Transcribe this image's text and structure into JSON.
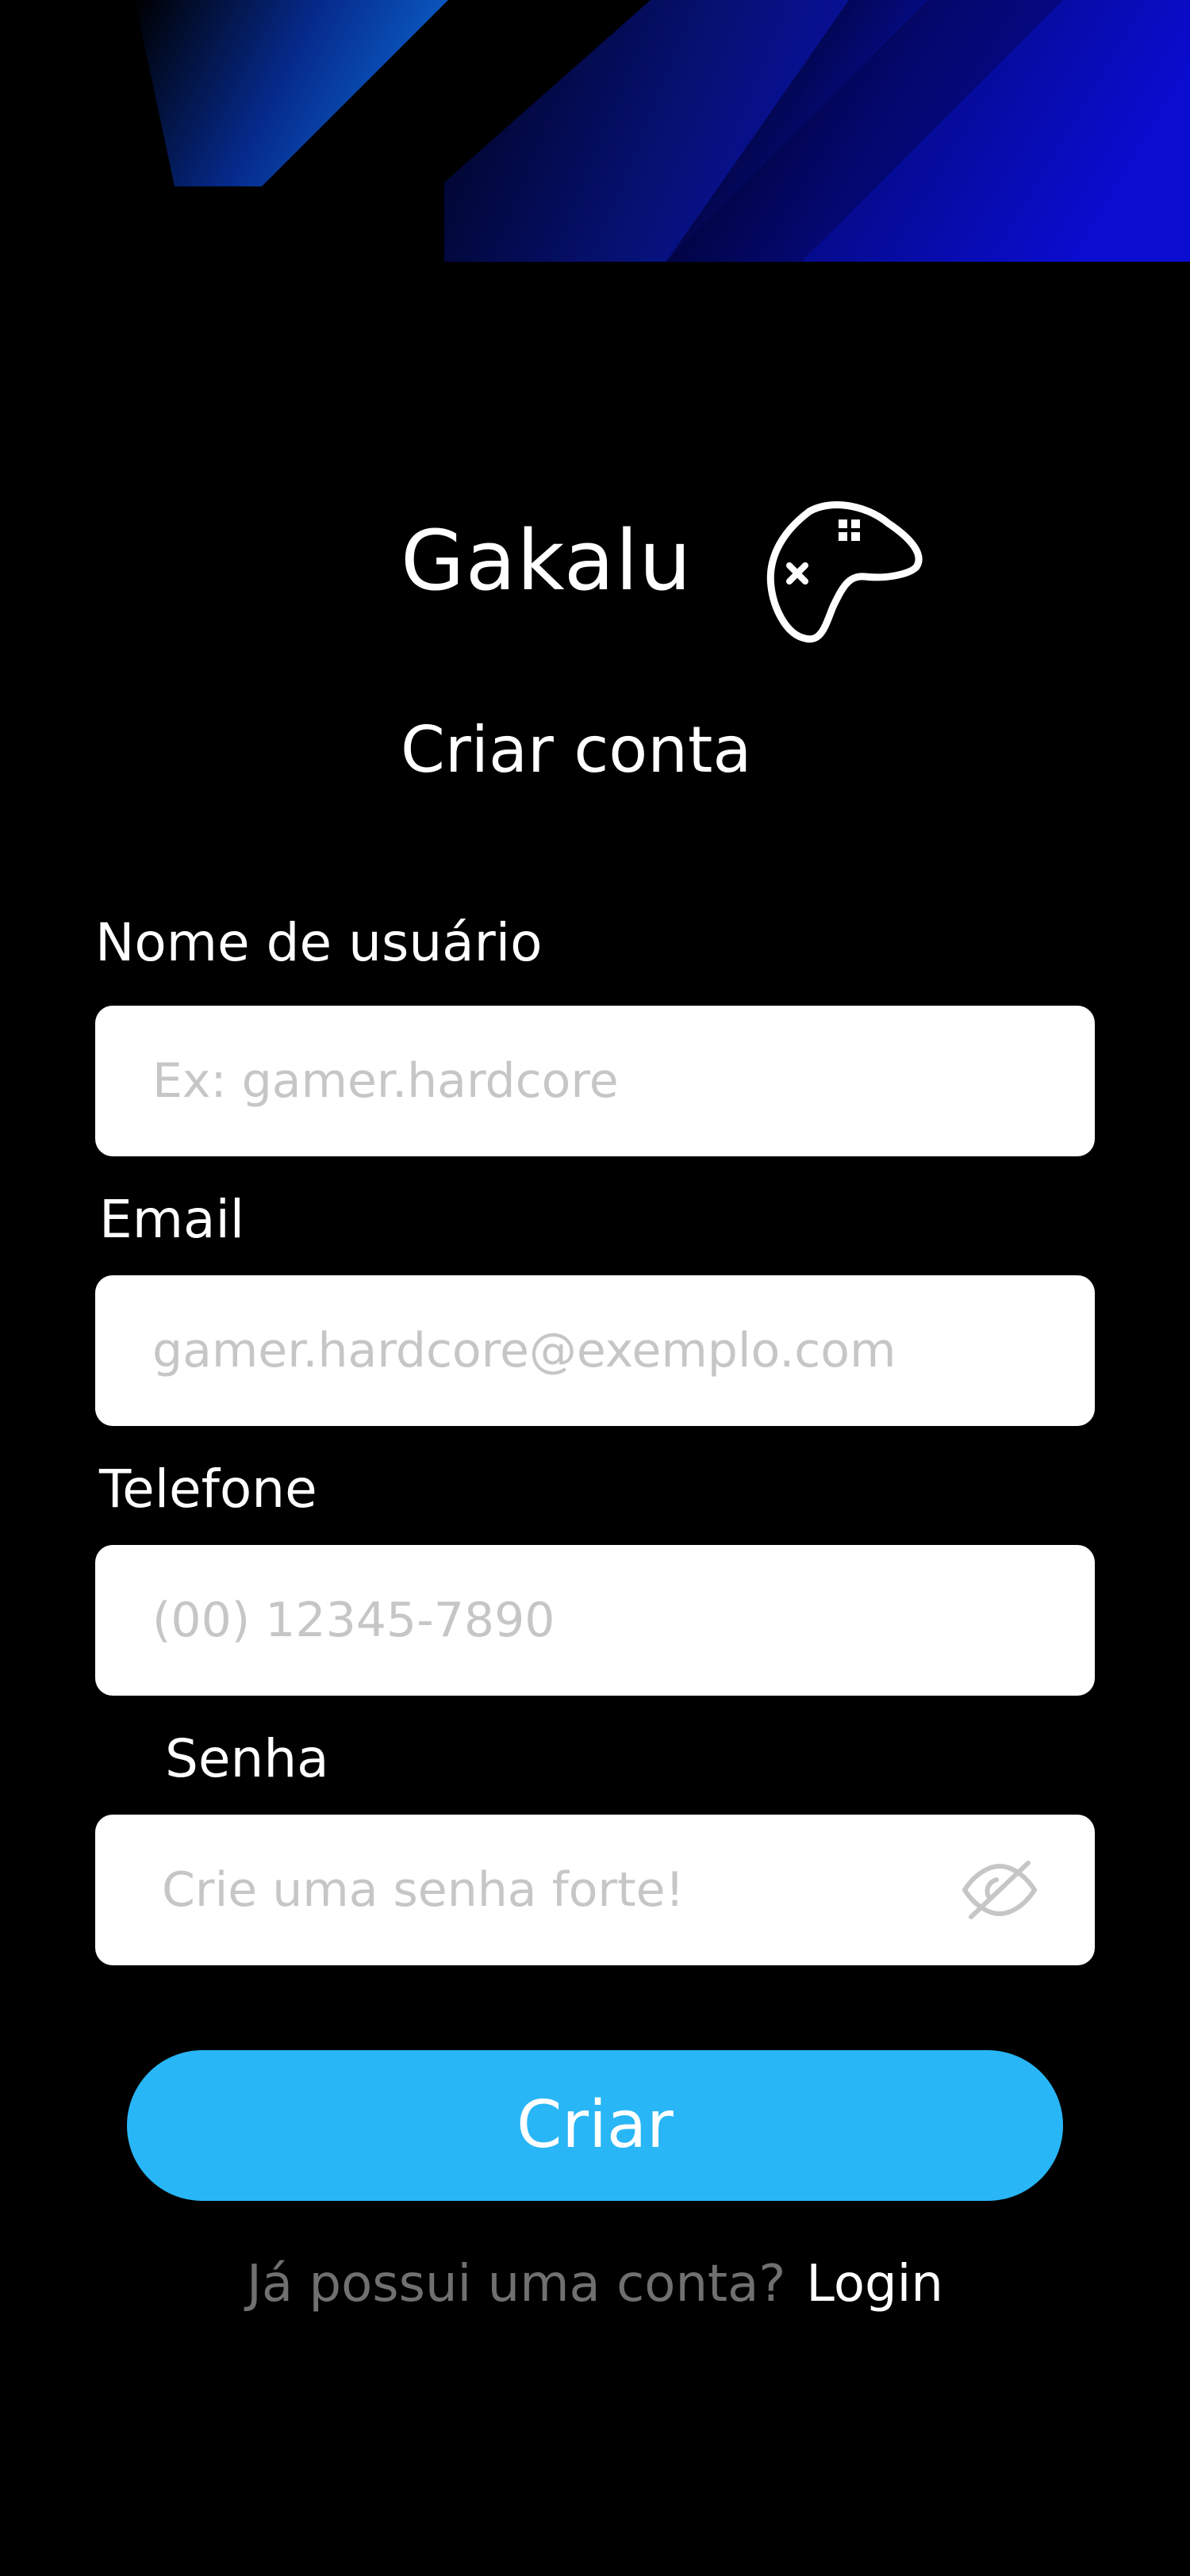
{
  "app": {
    "name": "Gakalu",
    "logo_icon": "gamepad-icon"
  },
  "page": {
    "title": "Criar conta"
  },
  "form": {
    "username": {
      "label": "Nome de usuário",
      "placeholder": "Ex: gamer.hardcore",
      "value": ""
    },
    "email": {
      "label": "Email",
      "placeholder": "gamer.hardcore@exemplo.com",
      "value": ""
    },
    "phone": {
      "label": "Telefone",
      "placeholder": "(00) 12345-7890",
      "value": ""
    },
    "password": {
      "label": "Senha",
      "placeholder": "Crie uma senha forte!",
      "value": "",
      "visibility_icon": "eye-off-icon"
    },
    "submit_label": "Criar"
  },
  "footer": {
    "prompt": "Já possui uma conta?",
    "link_label": "Login"
  },
  "colors": {
    "background": "#000000",
    "accent": "#29b6f6",
    "banner_blue": "#0a1fd6",
    "input_bg": "#ffffff",
    "placeholder": "#c6c6c6",
    "muted_text": "#707070"
  }
}
